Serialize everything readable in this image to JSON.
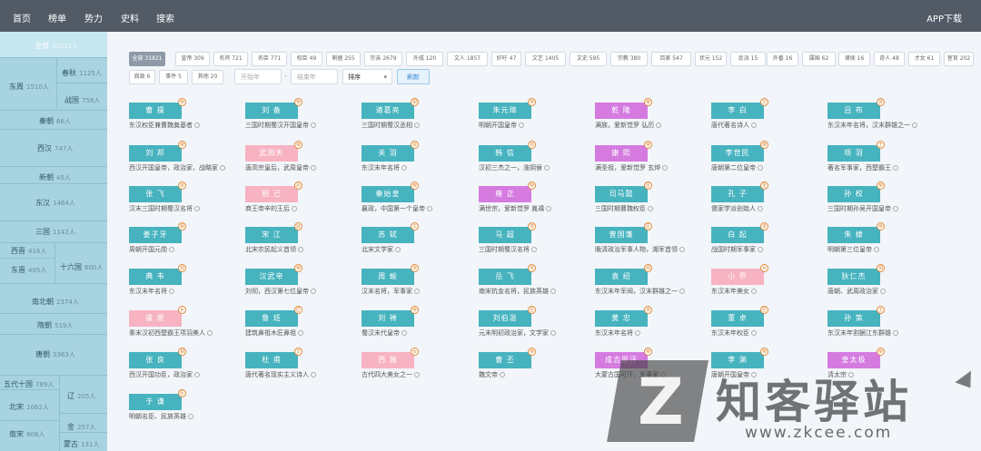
{
  "nav": {
    "items": [
      "首页",
      "榜单",
      "势力",
      "史料",
      "搜索"
    ],
    "app_download": "APP下载"
  },
  "sidebar": {
    "all": {
      "label": "全部",
      "count": "31821人"
    },
    "eras": [
      {
        "label": "东周",
        "count": "1510人"
      },
      {
        "label": "春秋",
        "count": "1125人"
      },
      {
        "label": "战国",
        "count": "758人"
      },
      {
        "label": "秦朝",
        "count": "66人"
      },
      {
        "label": "西汉",
        "count": "747人"
      },
      {
        "label": "新朝",
        "count": "45人"
      },
      {
        "label": "东汉",
        "count": "1464人"
      },
      {
        "label": "三国",
        "count": "1142人"
      },
      {
        "label": "西晋",
        "count": "416人"
      },
      {
        "label": "东晋",
        "count": "405人"
      },
      {
        "label": "十六国",
        "count": "600人"
      },
      {
        "label": "南北朝",
        "count": "2374人"
      },
      {
        "label": "隋朝",
        "count": "519人"
      },
      {
        "label": "唐朝",
        "count": "3363人"
      },
      {
        "label": "五代十国",
        "count": "789人"
      },
      {
        "label": "辽",
        "count": "205人"
      },
      {
        "label": "北宋",
        "count": "1062人"
      },
      {
        "label": "金",
        "count": "257人"
      },
      {
        "label": "南宋",
        "count": "808人"
      },
      {
        "label": "蒙古",
        "count": "131人"
      }
    ]
  },
  "filters": {
    "tags": [
      "全部 31821",
      "皇帝 309",
      "名将 721",
      "名臣 771",
      "权臣 49",
      "割据 255",
      "宗亲 2679",
      "外戚 120",
      "文人 1857",
      "奸吁 47",
      "文艺 1405",
      "文史 595",
      "宗教 380",
      "百家 547",
      "状元 152",
      "反派 15",
      "外番 16",
      "属国 62",
      "诸侯 16",
      "奇人 48",
      "才女 61",
      "宦官 202",
      "商政 6",
      "事件 5",
      "其他 20"
    ],
    "start_year_placeholder": "开始年",
    "dash": "-",
    "end_year_placeholder": "结束年",
    "sort_label": "排序",
    "refresh_label": "刷新"
  },
  "people": [
    {
      "name": "曹 操",
      "desc": "东汉权臣兼曹魏奠基者",
      "color": "#46b3bf",
      "badge": "帝"
    },
    {
      "name": "刘 备",
      "desc": "三国时期蜀汉开国皇帝",
      "color": "#46b3bf",
      "badge": "帝"
    },
    {
      "name": "诸葛亮",
      "desc": "三国时期蜀汉丞相",
      "color": "#46b3bf",
      "badge": "相"
    },
    {
      "name": "朱元璋",
      "desc": "明朝开国皇帝",
      "color": "#46b3bf",
      "badge": "帝"
    },
    {
      "name": "乾 隆",
      "desc": "满族，爱新觉罗 弘历",
      "color": "#d57be0",
      "badge": "帝"
    },
    {
      "name": "李 白",
      "desc": "唐代著名诗人",
      "color": "#46b3bf",
      "badge": "文"
    },
    {
      "name": "吕 布",
      "desc": "东汉末年名将，汉末群雄之一",
      "color": "#46b3bf",
      "badge": "将"
    },
    {
      "name": "刘 邦",
      "desc": "西汉开国皇帝，政治家，战略家",
      "color": "#46b3bf",
      "badge": "帝"
    },
    {
      "name": "武则天",
      "desc": "唐高宗皇后，武周皇帝",
      "color": "#f7b3c2",
      "badge": "帝"
    },
    {
      "name": "关 羽",
      "desc": "东汉末年名将",
      "color": "#46b3bf",
      "badge": "将"
    },
    {
      "name": "韩 信",
      "desc": "汉初三杰之一，淮阴侯",
      "color": "#46b3bf",
      "badge": "将"
    },
    {
      "name": "康 熙",
      "desc": "满圣祖，爱新觉罗 玄烨",
      "color": "#d57be0",
      "badge": "帝"
    },
    {
      "name": "李世民",
      "desc": "唐朝第二位皇帝",
      "color": "#46b3bf",
      "badge": "帝"
    },
    {
      "name": "项 羽",
      "desc": "著名军事家，西楚霸王",
      "color": "#46b3bf",
      "badge": "王"
    },
    {
      "name": "张 飞",
      "desc": "汉末三国时期蜀汉名将",
      "color": "#46b3bf",
      "badge": "将"
    },
    {
      "name": "妲 己",
      "desc": "商王帝辛的王后",
      "color": "#f7b3c2",
      "badge": "后"
    },
    {
      "name": "秦始皇",
      "desc": "嬴政，中国第一个皇帝",
      "color": "#46b3bf",
      "badge": "帝"
    },
    {
      "name": "雍 正",
      "desc": "满世宗，爱新觉罗 胤禛",
      "color": "#d57be0",
      "badge": "帝"
    },
    {
      "name": "司马懿",
      "desc": "三国时期曹魏权臣",
      "color": "#46b3bf",
      "badge": "臣"
    },
    {
      "name": "孔 子",
      "desc": "儒家学派创始人",
      "color": "#46b3bf",
      "badge": "圣"
    },
    {
      "name": "孙 权",
      "desc": "三国时期孙吴开国皇帝",
      "color": "#46b3bf",
      "badge": "帝"
    },
    {
      "name": "姜子牙",
      "desc": "周朝开国元勋",
      "color": "#46b3bf",
      "badge": "相"
    },
    {
      "name": "宋 江",
      "desc": "北宋农民起义首领",
      "color": "#46b3bf",
      "badge": "寇"
    },
    {
      "name": "苏 轼",
      "desc": "北宋文学家",
      "color": "#46b3bf",
      "badge": "文"
    },
    {
      "name": "马 超",
      "desc": "三国时期蜀汉名将",
      "color": "#46b3bf",
      "badge": "将"
    },
    {
      "name": "曾国藩",
      "desc": "晚清政治军事人物，湘军首领",
      "color": "#46b3bf",
      "badge": "臣"
    },
    {
      "name": "白 起",
      "desc": "战国时期军事家",
      "color": "#46b3bf",
      "badge": "将"
    },
    {
      "name": "朱 棣",
      "desc": "明朝第三位皇帝",
      "color": "#46b3bf",
      "badge": "帝"
    },
    {
      "name": "典 韦",
      "desc": "东汉末年名将",
      "color": "#46b3bf",
      "badge": "将"
    },
    {
      "name": "汉武帝",
      "desc": "刘彻，西汉第七位皇帝",
      "color": "#46b3bf",
      "badge": "帝"
    },
    {
      "name": "周 瑜",
      "desc": "汉末名将，军事家",
      "color": "#46b3bf",
      "badge": "将"
    },
    {
      "name": "岳 飞",
      "desc": "南宋抗金名将，民族英雄",
      "color": "#46b3bf",
      "badge": "将"
    },
    {
      "name": "袁 绍",
      "desc": "东汉末年军阀，汉末群雄之一",
      "color": "#46b3bf",
      "badge": "阀"
    },
    {
      "name": "小 乔",
      "desc": "东汉末年美女",
      "color": "#f7b3c2",
      "badge": "女"
    },
    {
      "name": "狄仁杰",
      "desc": "唐朝、武周政治家",
      "color": "#46b3bf",
      "badge": "相"
    },
    {
      "name": "虞 姬",
      "desc": "秦末汉初西楚霸王项羽美人",
      "color": "#f7b3c2",
      "badge": "女"
    },
    {
      "name": "鲁 班",
      "desc": "建筑鼻祖木匠鼻祖",
      "color": "#46b3bf",
      "badge": "匠"
    },
    {
      "name": "刘 禅",
      "desc": "蜀汉末代皇帝",
      "color": "#46b3bf",
      "badge": "帝"
    },
    {
      "name": "刘伯温",
      "desc": "元末明初政治家，文学家",
      "color": "#46b3bf",
      "badge": "臣"
    },
    {
      "name": "黄 忠",
      "desc": "东汉末年名将",
      "color": "#46b3bf",
      "badge": "将"
    },
    {
      "name": "董 卓",
      "desc": "东汉末年权臣",
      "color": "#46b3bf",
      "badge": "臣"
    },
    {
      "name": "孙 策",
      "desc": "东汉末年割据江东群雄",
      "color": "#46b3bf",
      "badge": "王"
    },
    {
      "name": "张 良",
      "desc": "西汉开国功臣，政治家",
      "color": "#46b3bf",
      "badge": "相"
    },
    {
      "name": "杜 甫",
      "desc": "唐代著名现实主义诗人",
      "color": "#46b3bf",
      "badge": "文"
    },
    {
      "name": "西 施",
      "desc": "古代四大美女之一",
      "color": "#f7b3c2",
      "badge": "女"
    },
    {
      "name": "曹 丕",
      "desc": "魏文帝",
      "color": "#46b3bf",
      "badge": "帝"
    },
    {
      "name": "成吉思汗",
      "desc": "大蒙古国可汗，军事家",
      "color": "#d57be0",
      "badge": "帝"
    },
    {
      "name": "李 渊",
      "desc": "唐朝开国皇帝",
      "color": "#46b3bf",
      "badge": "帝"
    },
    {
      "name": "皇太极",
      "desc": "清太宗",
      "color": "#d57be0",
      "badge": "帝"
    },
    {
      "name": "于 谦",
      "desc": "明朝名臣、民族英雄",
      "color": "#46b3bf",
      "badge": "臣"
    }
  ],
  "watermark": {
    "z": "Z",
    "title": "知客驿站",
    "url": "www.zkcee.com"
  }
}
